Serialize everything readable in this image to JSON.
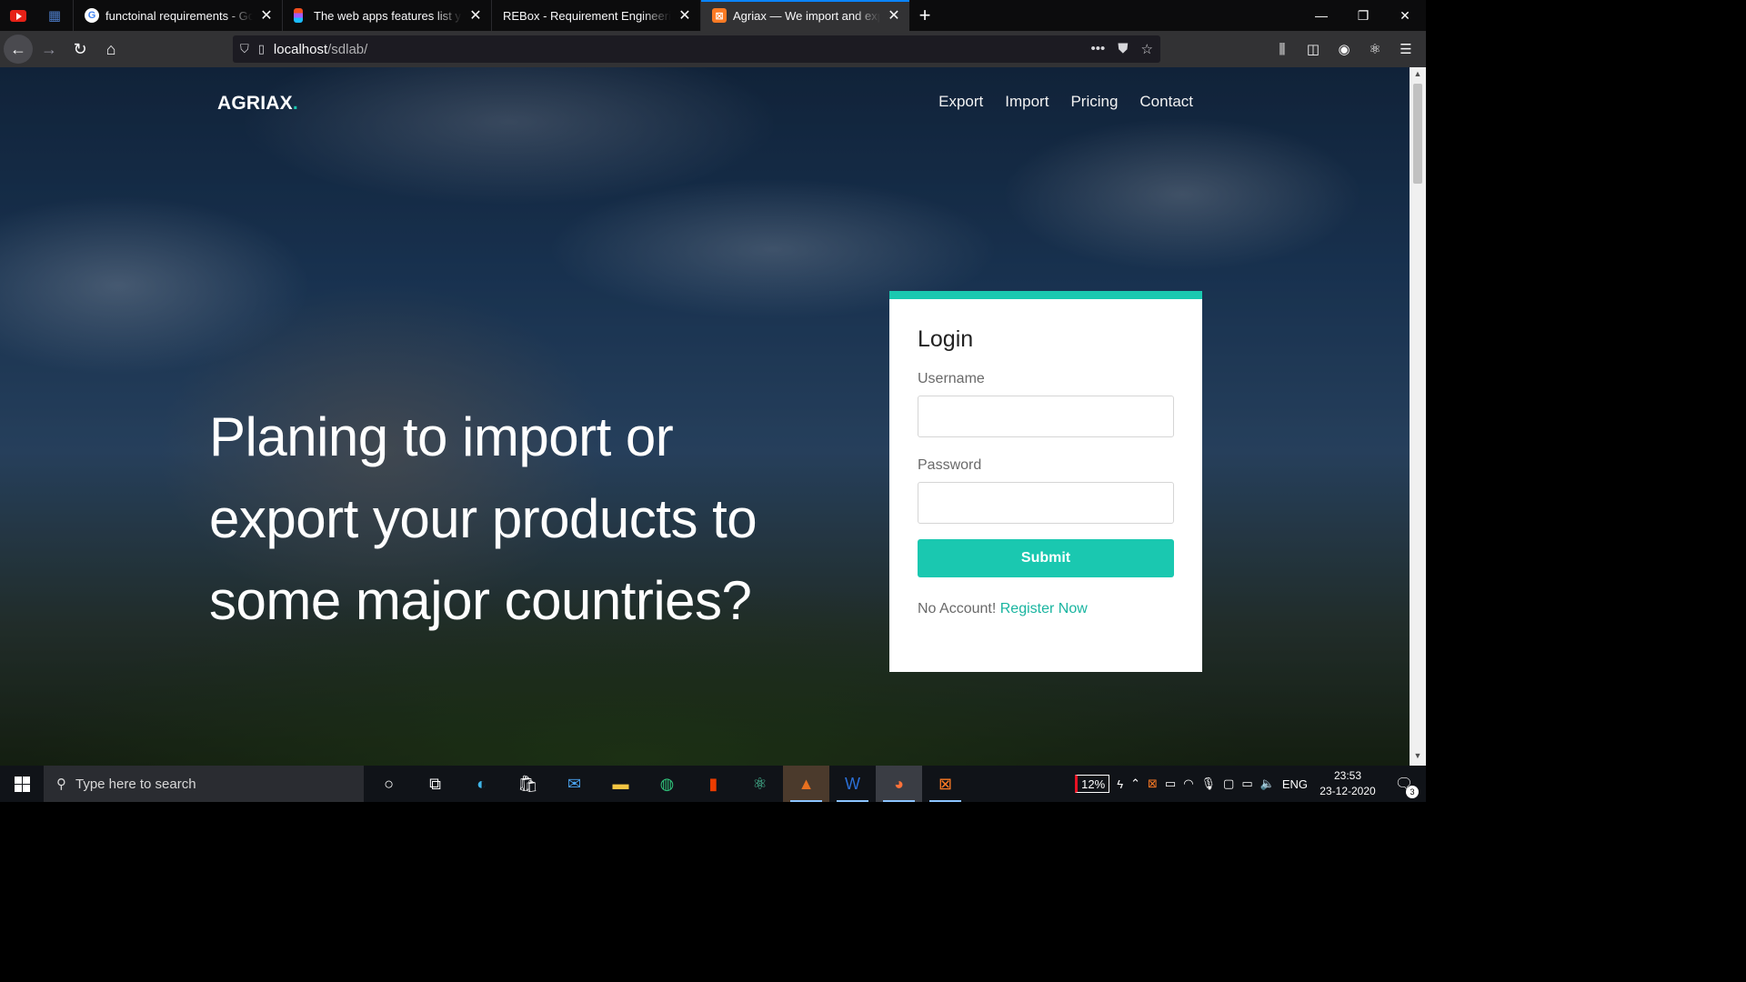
{
  "browser": {
    "tabs": [
      {
        "title": "functoinal requirements - Goo",
        "favicon": "google-icon"
      },
      {
        "title": "The web apps features list you",
        "favicon": "figma-icon"
      },
      {
        "title": "REBox - Requirement Engineering",
        "favicon": "none"
      },
      {
        "title": "Agriax — We import and expor",
        "favicon": "xampp-icon",
        "active": true
      }
    ],
    "url": {
      "host": "localhost",
      "path": "/sdlab/"
    }
  },
  "site": {
    "brand": "AGRIAX",
    "brand_dot": ".",
    "nav": [
      "Export",
      "Import",
      "Pricing",
      "Contact"
    ],
    "hero_headline": "Planing to import or export your products to some major countries?"
  },
  "login": {
    "title": "Login",
    "username_label": "Username",
    "password_label": "Password",
    "submit_label": "Submit",
    "no_account_text": "No Account!",
    "register_link": "Register Now"
  },
  "taskbar": {
    "search_placeholder": "Type here to search",
    "battery": "12%",
    "language": "ENG",
    "time": "23:53",
    "date": "23-12-2020",
    "notifications": "3"
  },
  "colors": {
    "accent": "#1ac8b0",
    "browser_tab_highlight": "#0a84ff"
  }
}
